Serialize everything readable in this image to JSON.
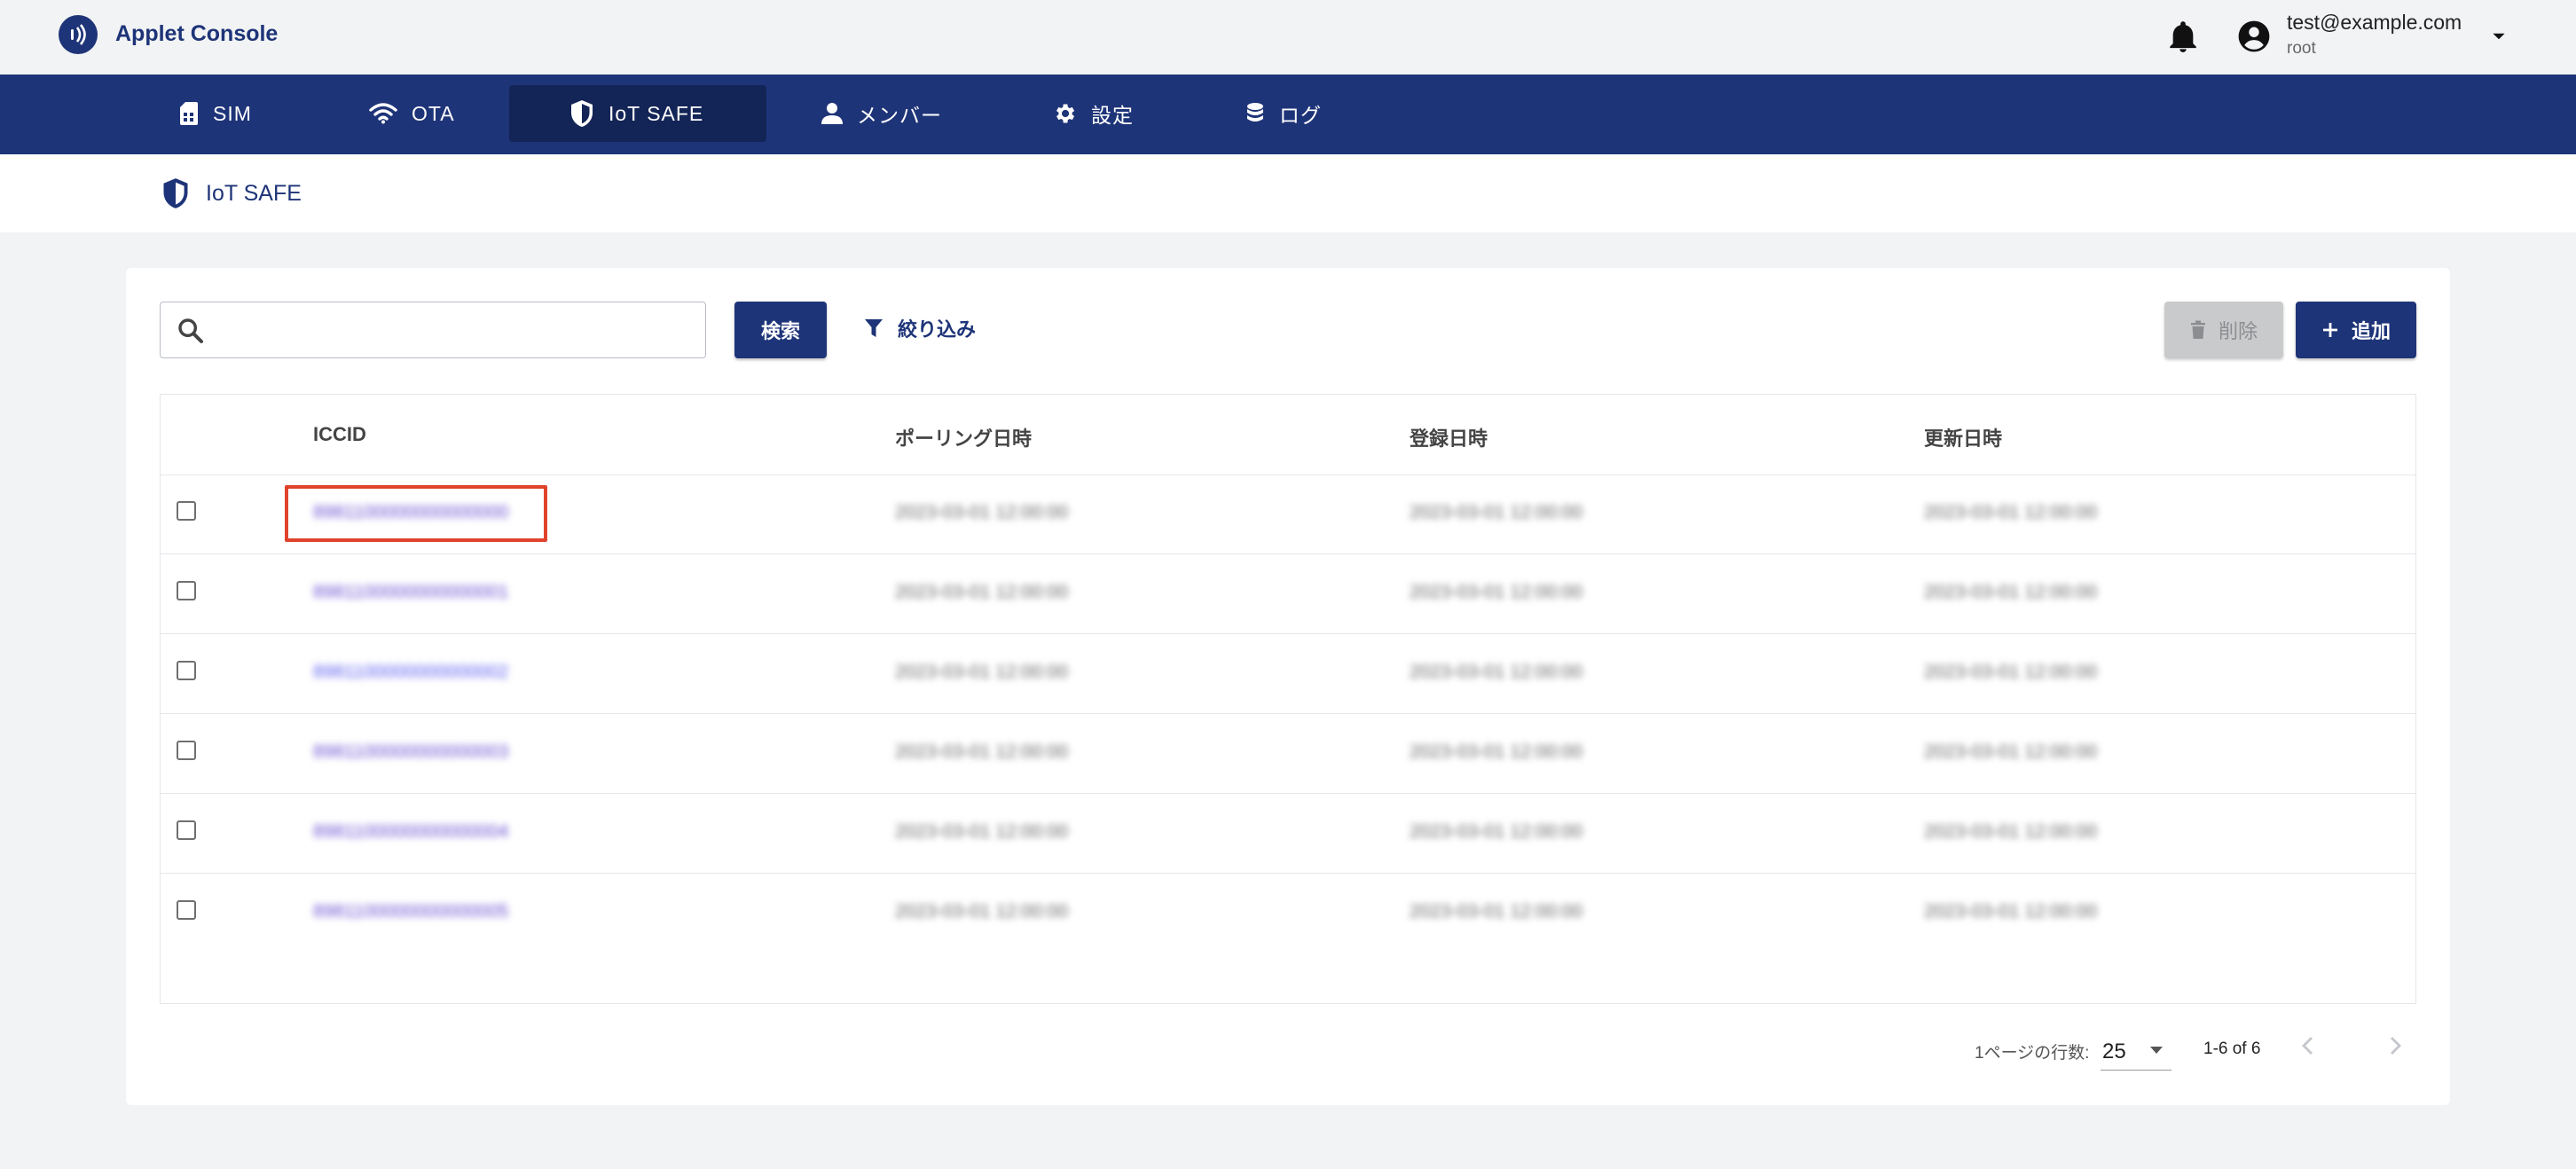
{
  "app": {
    "title": "Applet Console"
  },
  "user": {
    "email": "test@example.com",
    "role": "root"
  },
  "nav": {
    "items": [
      {
        "label": "SIM",
        "icon": "sim-card-icon"
      },
      {
        "label": "OTA",
        "icon": "wifi-icon"
      },
      {
        "label": "IoT SAFE",
        "icon": "shield-icon",
        "active": true
      },
      {
        "label": "メンバー",
        "icon": "person-icon"
      },
      {
        "label": "設定",
        "icon": "gear-icon"
      },
      {
        "label": "ログ",
        "icon": "database-icon"
      }
    ]
  },
  "breadcrumb": {
    "label": "IoT SAFE"
  },
  "toolbar": {
    "search_placeholder": "",
    "search_label": "検索",
    "filter_label": "絞り込み",
    "delete_label": "削除",
    "add_label": "追加"
  },
  "table": {
    "columns": [
      "ICCID",
      "ポーリング日時",
      "登録日時",
      "更新日時"
    ],
    "rows": [
      {
        "iccid": "8981100000000000000",
        "polling": "2023-03-01 12:00:00",
        "registered": "2023-03-01 12:00:00",
        "updated": "2023-03-01 12:00:00"
      },
      {
        "iccid": "8981100000000000001",
        "polling": "2023-03-01 12:00:00",
        "registered": "2023-03-01 12:00:00",
        "updated": "2023-03-01 12:00:00"
      },
      {
        "iccid": "8981100000000000002",
        "polling": "2023-03-01 12:00:00",
        "registered": "2023-03-01 12:00:00",
        "updated": "2023-03-01 12:00:00"
      },
      {
        "iccid": "8981100000000000003",
        "polling": "2023-03-01 12:00:00",
        "registered": "2023-03-01 12:00:00",
        "updated": "2023-03-01 12:00:00"
      },
      {
        "iccid": "8981100000000000004",
        "polling": "2023-03-01 12:00:00",
        "registered": "2023-03-01 12:00:00",
        "updated": "2023-03-01 12:00:00"
      },
      {
        "iccid": "8981100000000000005",
        "polling": "2023-03-01 12:00:00",
        "registered": "2023-03-01 12:00:00",
        "updated": "2023-03-01 12:00:00"
      }
    ]
  },
  "pagination": {
    "rows_per_page_label": "1ページの行数:",
    "rows_per_page": "25",
    "range": "1-6 of 6"
  },
  "colors": {
    "primary": "#1e3478",
    "highlight": "#e0432b",
    "link": "#6a4fd1"
  }
}
